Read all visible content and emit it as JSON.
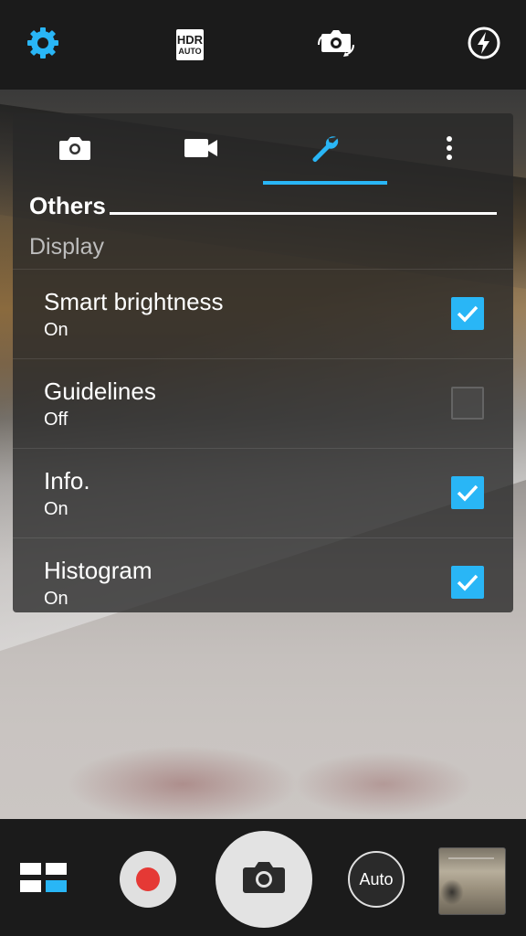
{
  "topbar": {
    "hdr": {
      "line1": "HDR",
      "line2": "AUTO"
    },
    "icons": [
      "gear-icon",
      "hdr-auto-icon",
      "switch-camera-icon",
      "flash-auto-icon"
    ],
    "accent": "#29b6f6"
  },
  "panel": {
    "tabs": [
      "camera-icon",
      "video-icon",
      "wrench-icon",
      "more-vert-icon"
    ],
    "active_tab": 2,
    "section_title": "Others",
    "subheader": "Display",
    "rows": [
      {
        "title": "Smart brightness",
        "value": "On",
        "checked": true
      },
      {
        "title": "Guidelines",
        "value": "Off",
        "checked": false
      },
      {
        "title": "Info.",
        "value": "On",
        "checked": true
      },
      {
        "title": "Histogram",
        "value": "On",
        "checked": true
      }
    ]
  },
  "bottombar": {
    "mode_label": "Auto",
    "icons": [
      "mode-grid-icon",
      "record-icon",
      "camera-shutter-icon",
      "auto-mode-icon",
      "gallery-thumbnail"
    ],
    "record_color": "#e53935"
  }
}
